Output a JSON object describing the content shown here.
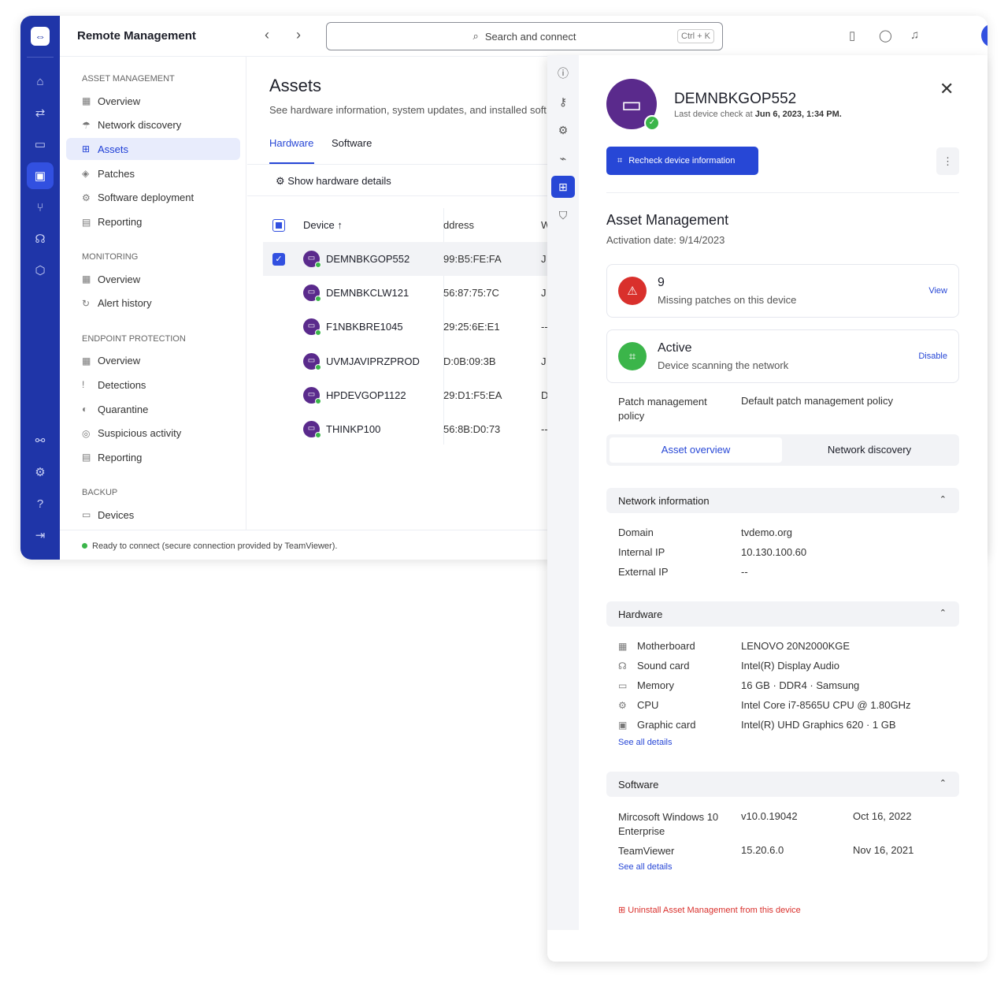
{
  "app": {
    "title": "Remote Management",
    "search_placeholder": "Search and connect",
    "search_shortcut": "Ctrl + K",
    "status": "Ready to connect (secure connection provided by TeamViewer)."
  },
  "colors": {
    "rail": "#1f35a8",
    "accent": "#2747d6",
    "device_avatar": "#5a2a8c",
    "online": "#3bb54a",
    "danger": "#d9302c"
  },
  "sidebar": {
    "sections": [
      {
        "title": "ASSET MANAGEMENT",
        "items": [
          {
            "label": "Overview",
            "icon": "overview-icon"
          },
          {
            "label": "Network discovery",
            "icon": "network-icon"
          },
          {
            "label": "Assets",
            "icon": "assets-icon",
            "active": true
          },
          {
            "label": "Patches",
            "icon": "patches-icon"
          },
          {
            "label": "Software deployment",
            "icon": "software-deployment-icon"
          },
          {
            "label": "Reporting",
            "icon": "reporting-icon"
          }
        ]
      },
      {
        "title": "MONITORING",
        "items": [
          {
            "label": "Overview",
            "icon": "overview-icon"
          },
          {
            "label": "Alert history",
            "icon": "alert-history-icon"
          }
        ]
      },
      {
        "title": "ENDPOINT PROTECTION",
        "items": [
          {
            "label": "Overview",
            "icon": "overview-icon"
          },
          {
            "label": "Detections",
            "icon": "detections-icon"
          },
          {
            "label": "Quarantine",
            "icon": "quarantine-icon"
          },
          {
            "label": "Suspicious activity",
            "icon": "suspicious-activity-icon"
          },
          {
            "label": "Reporting",
            "icon": "reporting-icon"
          }
        ]
      },
      {
        "title": "BACKUP",
        "items": [
          {
            "label": "Devices",
            "icon": "devices-icon"
          }
        ]
      }
    ]
  },
  "main": {
    "title": "Assets",
    "subtitle": "See hardware information, system updates, and installed soft",
    "tabs": [
      {
        "label": "Hardware",
        "active": true
      },
      {
        "label": "Software"
      }
    ],
    "show_details": "Show hardware details",
    "columns": [
      "Device",
      "ddress",
      "W"
    ],
    "rows": [
      {
        "device": "DEMNBKGOP552",
        "address": "99:B5:FE:FA",
        "w": "J",
        "selected": true
      },
      {
        "device": "DEMNBKCLW121",
        "address": "56:87:75:7C",
        "w": "J"
      },
      {
        "device": "F1NBKBRE1045",
        "address": "29:25:6E:E1",
        "w": "--"
      },
      {
        "device": "UVMJAVIPRZPROD",
        "address": "D:0B:09:3B",
        "w": "J"
      },
      {
        "device": "HPDEVGOP1122",
        "address": "29:D1:F5:EA",
        "w": "D"
      },
      {
        "device": "THINKP100",
        "address": "56:8B:D0:73",
        "w": "--"
      }
    ]
  },
  "panel": {
    "device": "DEMNBKGOP552",
    "last_check_prefix": "Last device check at ",
    "last_check": "Jun 6, 2023, 1:34 PM.",
    "recheck": "Recheck device information",
    "am_title": "Asset Management",
    "activation": "Activation date: 9/14/2023",
    "patches": {
      "count": "9",
      "text": "Missing patches on this device",
      "action": "View"
    },
    "scan": {
      "title": "Active",
      "text": "Device scanning the network",
      "action": "Disable"
    },
    "policy_label": "Patch management policy",
    "policy_value": "Default patch management policy",
    "subtabs": [
      {
        "label": "Asset overview",
        "active": true
      },
      {
        "label": "Network discovery"
      }
    ],
    "network": {
      "title": "Network information",
      "rows": [
        {
          "k": "Domain",
          "v": "tvdemo.org"
        },
        {
          "k": "Internal IP",
          "v": "10.130.100.60"
        },
        {
          "k": "External IP",
          "v": "--"
        }
      ]
    },
    "hardware": {
      "title": "Hardware",
      "rows": [
        {
          "k": "Motherboard",
          "v": "LENOVO 20N2000KGE",
          "icon": "motherboard-icon"
        },
        {
          "k": "Sound card",
          "v": "Intel(R) Display Audio",
          "icon": "headphones-icon"
        },
        {
          "k": "Memory",
          "v": "16 GB · DDR4 · Samsung",
          "icon": "memory-icon"
        },
        {
          "k": "CPU",
          "v": "Intel Core i7-8565U CPU @ 1.80GHz",
          "icon": "cpu-icon"
        },
        {
          "k": "Graphic card",
          "v": "Intel(R) UHD Graphics 620 · 1 GB",
          "icon": "graphics-card-icon"
        }
      ],
      "see_all": "See all details"
    },
    "software": {
      "title": "Software",
      "rows": [
        {
          "name": "Mircosoft Windows 10 Enterprise",
          "version": "v10.0.19042",
          "date": "Oct 16, 2022"
        },
        {
          "name": "TeamViewer",
          "version": "15.20.6.0",
          "date": "Nov 16, 2021"
        }
      ],
      "see_all": "See all details"
    },
    "uninstall": "Uninstall Asset Management from this device"
  }
}
